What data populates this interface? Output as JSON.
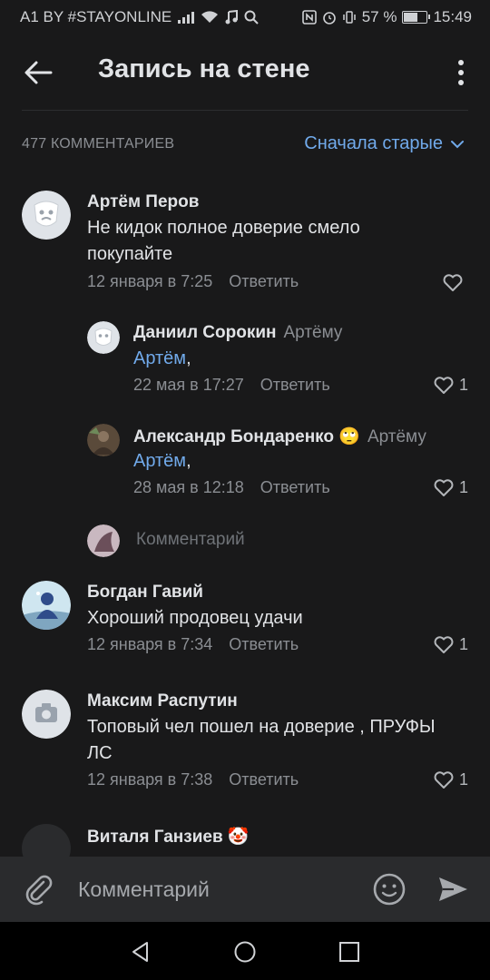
{
  "status_bar": {
    "carrier": "A1 BY #STAYONLINE",
    "battery_text": "57 %",
    "battery_level": 0.57,
    "time": "15:49"
  },
  "toolbar": {
    "title": "Запись на стене"
  },
  "comments_header": {
    "count": "477 КОММЕНТАРИЕВ",
    "sort": "Сначала старые"
  },
  "comments": [
    {
      "author": "Артём Перов",
      "text": "Не кидок полное доверие смело покупайте",
      "date": "12 января в 7:25",
      "reply_label": "Ответить",
      "likes": ""
    },
    {
      "author": "Даниил Сорокин",
      "reply_to": "Артёму",
      "mention": "Артём",
      "text_rest": ",",
      "date": "22 мая в 17:27",
      "reply_label": "Ответить",
      "likes": "1"
    },
    {
      "author": "Александр Бондаренко 🙄",
      "reply_to": "Артёму",
      "mention": "Артём",
      "text_rest": ",",
      "date": "28 мая в 12:18",
      "reply_label": "Ответить",
      "likes": "1"
    },
    {
      "author": "Богдан Гавий",
      "text": "Хороший продовец удачи",
      "date": "12 января в 7:34",
      "reply_label": "Ответить",
      "likes": "1"
    },
    {
      "author": "Максим Распутин",
      "text": "Топовый чел пошел на доверие , ПРУФЫ ЛС",
      "date": "12 января в 7:38",
      "reply_label": "Ответить",
      "likes": "1"
    },
    {
      "author": "Виталя Ганзиев 🤡"
    }
  ],
  "thread_reply": {
    "placeholder": "Комментарий"
  },
  "composer": {
    "placeholder": "Комментарий"
  },
  "colors": {
    "background": "#19191a",
    "accent": "#71aaeb",
    "secondary_text": "#8b8e93"
  }
}
